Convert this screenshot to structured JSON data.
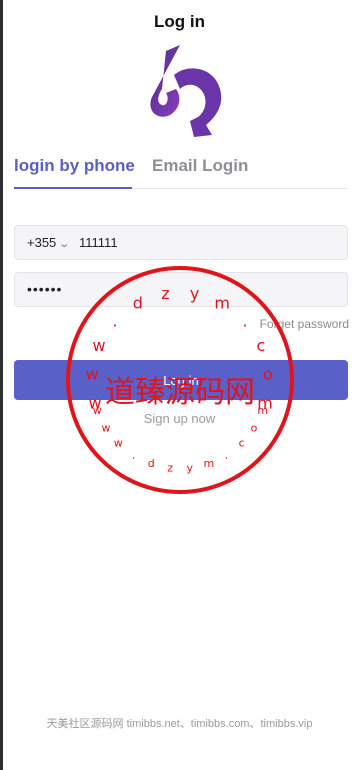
{
  "header": {
    "title": "Log in"
  },
  "logo": {
    "name": "logo-mark",
    "colors": {
      "dark": "#4a2a8c",
      "light": "#8a3fb8"
    }
  },
  "tabs": [
    {
      "label": "login by phone",
      "active": true
    },
    {
      "label": "Email Login",
      "active": false
    }
  ],
  "phone": {
    "country_code": "+355",
    "value": "111111"
  },
  "password": {
    "value": "••••••"
  },
  "forgot_label": "Forget password",
  "login_label": "Log in",
  "signup_label": "Sign up now",
  "watermark": {
    "center_text": "道臻源码网",
    "ring_text": "www.dzym.com",
    "color": "#e0141b"
  },
  "footer_text": "天美社区源码网 timibbs.net、timibbs.com、timibbs.vip",
  "accent_color": "#5960c8"
}
